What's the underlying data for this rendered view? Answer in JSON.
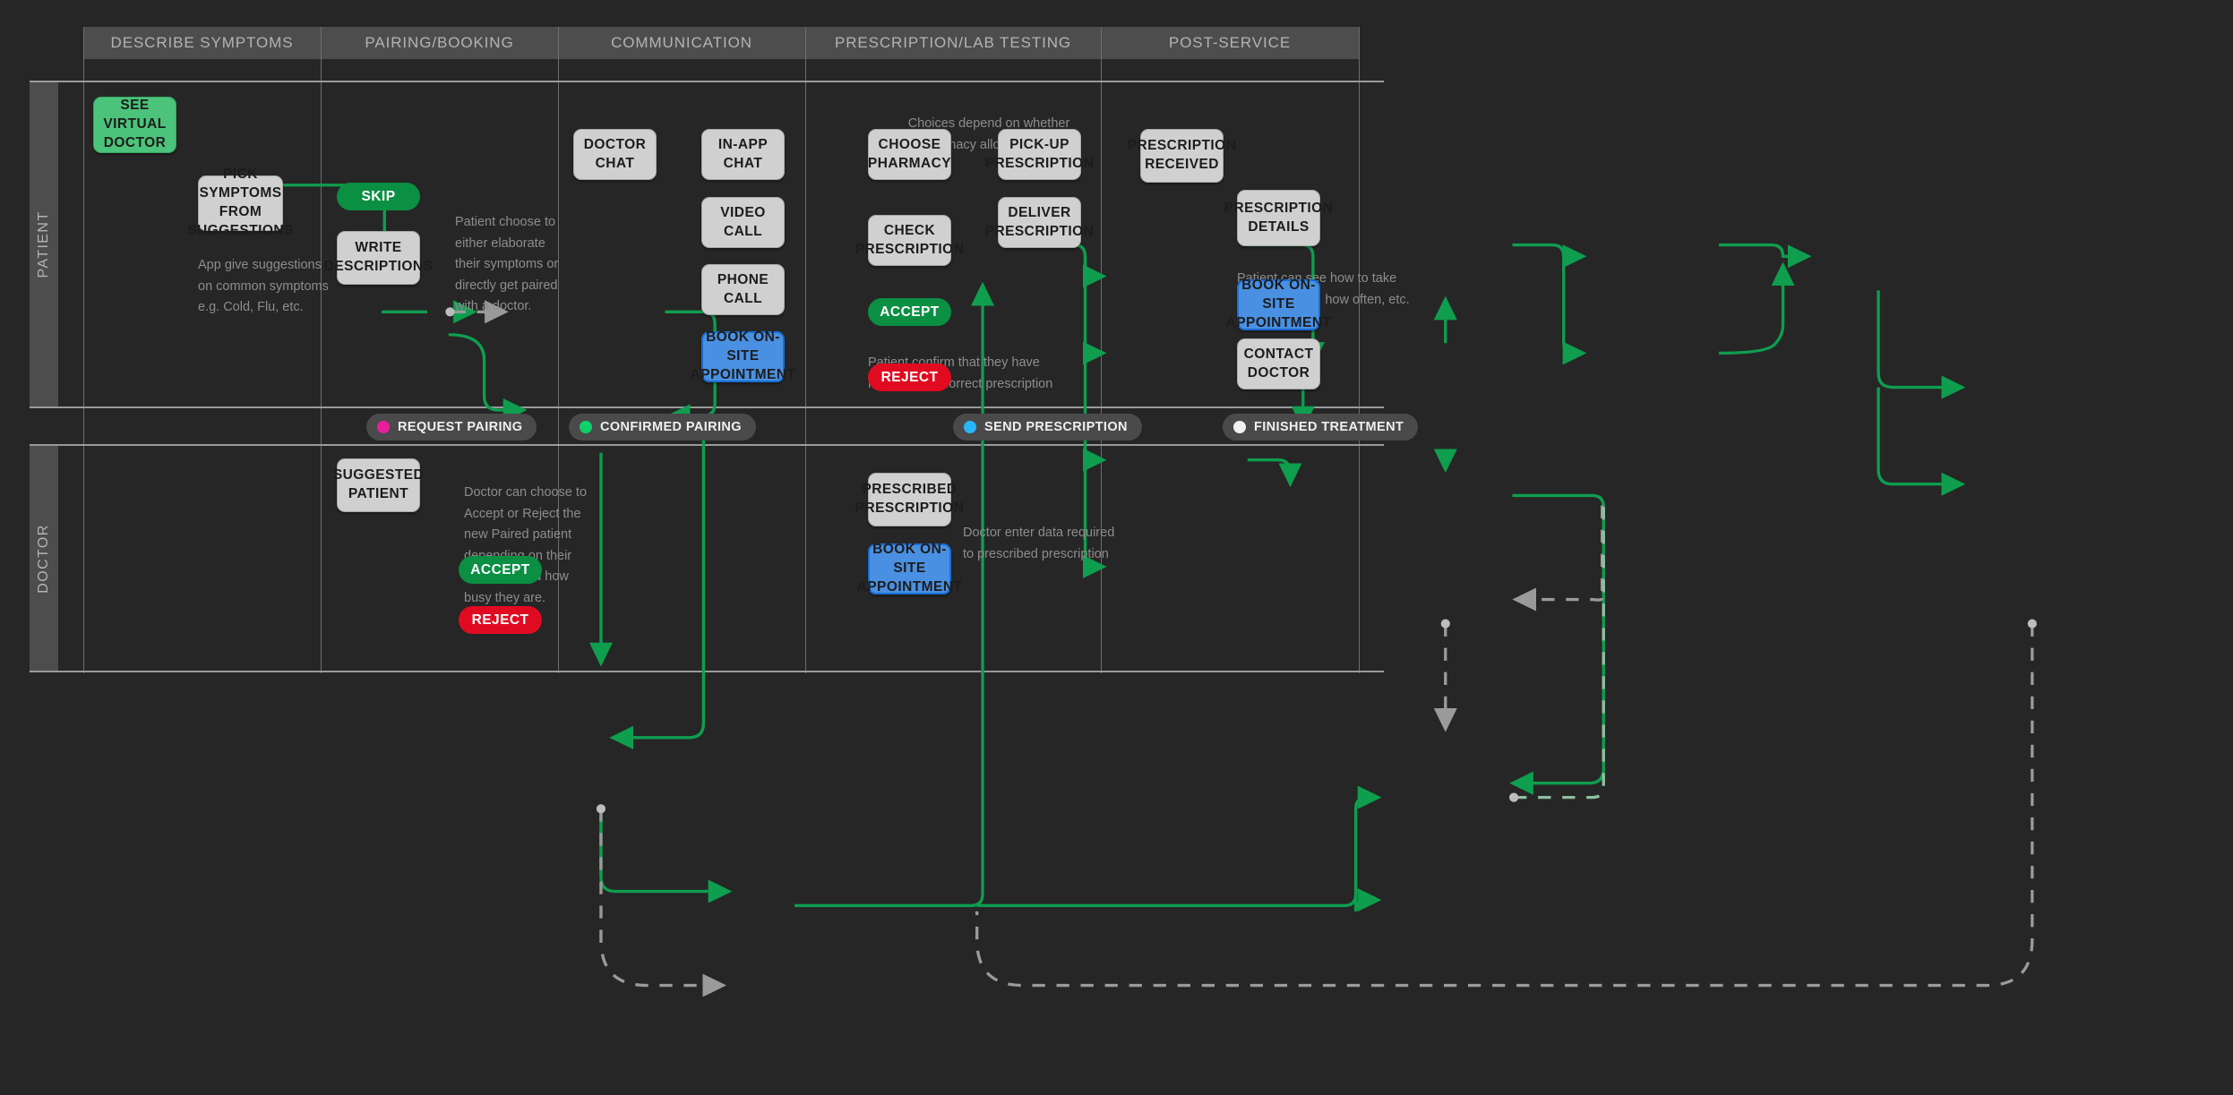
{
  "lanes": {
    "columns": [
      {
        "label": "DESCRIBE SYMPTOMS"
      },
      {
        "label": "PAIRING/BOOKING"
      },
      {
        "label": "COMMUNICATION"
      },
      {
        "label": "PRESCRIPTION/LAB TESTING"
      },
      {
        "label": "POST-SERVICE"
      }
    ],
    "rows": [
      {
        "label": "PATIENT"
      },
      {
        "label": "DOCTOR"
      }
    ]
  },
  "status_chips": [
    {
      "label": "REQUEST PAIRING",
      "color": "#e91e9b"
    },
    {
      "label": "CONFIRMED PAIRING",
      "color": "#0ed16a"
    },
    {
      "label": "SEND PRESCRIPTION",
      "color": "#29b6f6"
    },
    {
      "label": "FINISHED TREATMENT",
      "color": "#f2f2f2"
    }
  ],
  "patient_nodes": [
    {
      "id": "see-virtual-doctor",
      "label": "SEE VIRTUAL DOCTOR",
      "style": "light-green"
    },
    {
      "id": "pick-symptoms",
      "label": "PICK SYMPTOMS FROM SUGGESTIONS",
      "style": "grey"
    },
    {
      "id": "skip",
      "label": "SKIP",
      "style": "green-pill"
    },
    {
      "id": "write-descriptions",
      "label": "WRITE DESCRIPTIONS",
      "style": "grey"
    },
    {
      "id": "doctor-chat",
      "label": "DOCTOR CHAT",
      "style": "grey"
    },
    {
      "id": "in-app-chat",
      "label": "IN-APP CHAT",
      "style": "grey"
    },
    {
      "id": "video-call",
      "label": "VIDEO CALL",
      "style": "grey"
    },
    {
      "id": "phone-call",
      "label": "PHONE CALL",
      "style": "grey"
    },
    {
      "id": "book-on-site-appointment-communication",
      "label": "BOOK ON-SITE APPOINTMENT",
      "style": "blue"
    },
    {
      "id": "choose-pharmacy",
      "label": "CHOOSE PHARMACY",
      "style": "grey"
    },
    {
      "id": "check-prescription",
      "label": "CHECK PRESCRIPTION",
      "style": "grey"
    },
    {
      "id": "pick-up-prescription",
      "label": "PICK-UP PRESCRIPTION",
      "style": "grey"
    },
    {
      "id": "deliver-prescription",
      "label": "DELIVER PRESCRIPTION",
      "style": "grey"
    },
    {
      "id": "accept-prescription",
      "label": "ACCEPT",
      "style": "green-pill"
    },
    {
      "id": "reject-prescription",
      "label": "REJECT",
      "style": "red-pill"
    },
    {
      "id": "prescription-received",
      "label": "PRESCRIPTION RECEIVED",
      "style": "grey"
    },
    {
      "id": "prescription-details",
      "label": "PRESCRIPTION DETAILS",
      "style": "grey"
    },
    {
      "id": "book-on-site-appointment-post",
      "label": "BOOK ON-SITE APPOINTMENT",
      "style": "blue"
    },
    {
      "id": "contact-doctor",
      "label": "CONTACT DOCTOR",
      "style": "grey"
    }
  ],
  "doctor_nodes": [
    {
      "id": "suggested-patient",
      "label": "SUGGESTED PATIENT",
      "style": "grey"
    },
    {
      "id": "accept-patient",
      "label": "ACCEPT",
      "style": "green-pill"
    },
    {
      "id": "reject-patient",
      "label": "REJECT",
      "style": "red-pill"
    },
    {
      "id": "prescribed-prescription",
      "label": "PRESCRIBED PRESCRIPTION",
      "style": "grey"
    },
    {
      "id": "book-on-site-appointment-doctor",
      "label": "BOOK ON-SITE APPOINTMENT",
      "style": "blue"
    }
  ],
  "notes": {
    "app_suggestions": "App give suggestions\non common symptoms\ne.g. Cold, Flu, etc.",
    "patient_choose": "Patient choose to\neither elaborate\ntheir symptoms or\ndirectly get paired\nwith a doctor.",
    "pharmacy_delivery": "Choices depend on whether\nPharmacy allow Delivery",
    "patient_confirm": "Patient confirm that they have\nreceived the correct prescription",
    "prescription_details_note": "Patient can see how to take\ntheir medicine, how often, etc.",
    "doctor_choose": "Doctor can choose to\nAccept or Reject the\nnew Paired patient\ndepending on their\nschedule and how\nbusy they are.",
    "doctor_enter_data": "Doctor enter data required\nto prescribed prescription"
  },
  "colors": {
    "background": "#262626",
    "lane_header": "#4d4d4d",
    "flow_green": "#0e9e4e",
    "flow_dashed": "#9a9a9a",
    "node_grey": "#d0d0d0",
    "node_blue": "#4a90e2",
    "node_light_green": "#4cc37a",
    "pill_green": "#0a8f43",
    "pill_red": "#e00b21"
  }
}
